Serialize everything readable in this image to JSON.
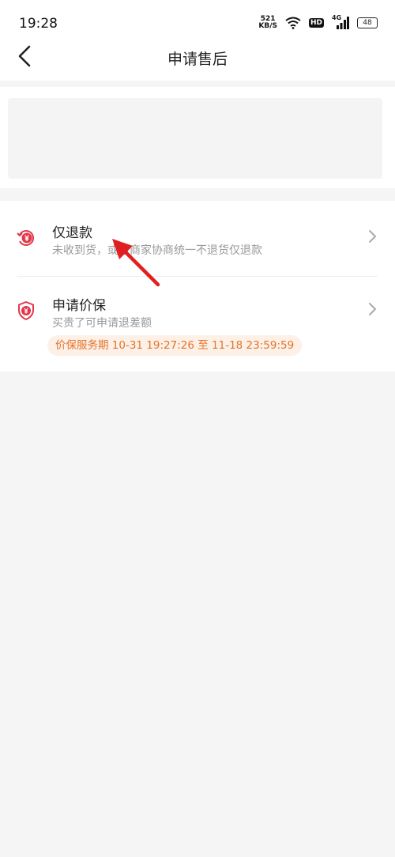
{
  "status_bar": {
    "time": "19:28",
    "net_speed_value": "521",
    "net_speed_unit": "KB/S",
    "hd_label": "HD",
    "signal_label": "4G",
    "battery_level": "48"
  },
  "nav": {
    "title": "申请售后",
    "back_icon": "chevron-left-icon"
  },
  "options": [
    {
      "title": "仅退款",
      "description": "未收到货，或与商家协商统一不退货仅退款",
      "icon": "refund-icon",
      "icon_color": "#e0384b"
    },
    {
      "title": "申请价保",
      "description": "买贵了可申请退差额",
      "icon": "price-protect-shield-icon",
      "icon_color": "#e0384b",
      "badge": "价保服务期 10-31 19:27:26 至 11-18 23:59:59"
    }
  ],
  "colors": {
    "accent_red": "#e0384b",
    "badge_text": "#e4742c",
    "badge_bg": "#fdf0e6",
    "annotation_arrow": "#e02020"
  }
}
